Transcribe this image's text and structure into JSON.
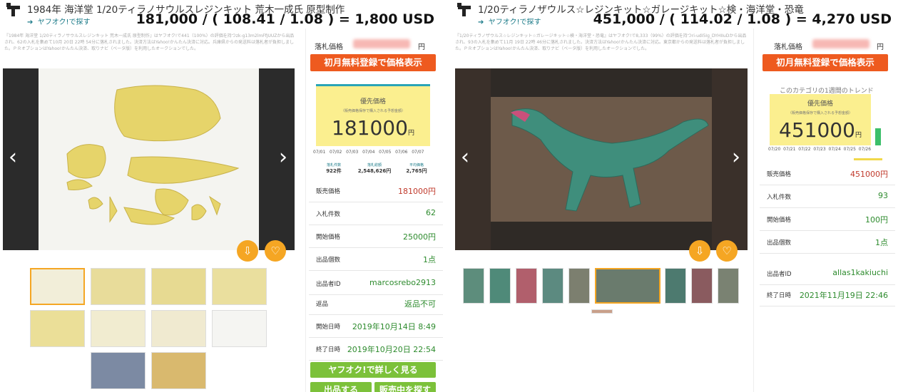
{
  "left": {
    "title": "1984年 海洋堂 1/20ティラノサウルスレジンキット 荒木一成氏 原型制作",
    "yahoo_link": "ヤフオク!で探す",
    "formula": "181,000 / ( 108.41 / 1.08 ) = 1,800 USD",
    "description": "『1984年 海洋堂 1/20ティラノサウルスレジンキット 荒木一成氏 原型制作』はヤフオク!で441（100%）の評価を持つzk-g13m2lmFfJUUZから出品され、62の入札を集めて10月 20日 22時 54分に落札されました。決済方法はYahoo!かんたん決済に対応。兵庫県からの発送料は落札者が負担しました。ＰＲオプションはYahoo!かんたん決済、取りナビ（ベータ版）を利用したオークションでした。",
    "price_label": "落札価格",
    "price_unit": "円",
    "register_button": "初月無料登録で価格表示",
    "priority_label": "優先価格",
    "priority_note": "（販売価格保存で購入される予想金額）",
    "priority_value": "181000",
    "priority_unit": "円",
    "dates": [
      "07/01",
      "07/02",
      "07/03",
      "07/04",
      "07/05",
      "07/06",
      "07/07"
    ],
    "stats": [
      {
        "label": "落札件数",
        "value": "922件"
      },
      {
        "label": "落札総額",
        "value": "2,548,626円"
      },
      {
        "label": "平均価格",
        "value": "2,765円"
      }
    ],
    "rows": [
      {
        "key": "販売価格",
        "value": "181000円",
        "red": true
      },
      {
        "key": "入札件数",
        "value": "62"
      },
      {
        "key": "開始価格",
        "value": "25000円"
      },
      {
        "key": "出品個数",
        "value": "1点"
      },
      {
        "key": "出品者ID",
        "value": "marcosrebo2913"
      },
      {
        "key": "返品",
        "value": "返品不可"
      },
      {
        "key": "開始日時",
        "value": "2019年10月14日 8:49"
      },
      {
        "key": "終了日時",
        "value": "2019年10月20日 22:54"
      }
    ],
    "detail_button": "ヤフオク!で詳しく見る",
    "sell_button": "出品する",
    "search_button": "販売中を探す"
  },
  "right": {
    "title": "1/20ティラノザウルス☆レジンキット☆ガレージキット☆検・海洋堂・恐竜",
    "yahoo_link": "ヤフオク!で探す",
    "formula": "451,000 / ( 114.02 / 1.08 ) = 4,270 USD",
    "description": "『1/20ティラノザウルス☆レジンキット☆ガレージキット☆検・海洋堂・恐竜』はヤフオク!で8,333（99%）の評価を持つri-udI5Ig_DYHIIuDから出品され、93の入札を集めて11月 19日 22時 46分に落札されました。決済方法はYahoo!かんたん決済に対応。東京都からの発送料は落札者が負担しました。ＰＲオプションはYahoo!かんたん決済、取りナビ（ベータ版）を利用したオークションでした。",
    "price_label": "落札価格",
    "price_unit": "円",
    "register_button": "初月無料登録で価格表示",
    "trend_label": "このカテゴリの1週間のトレンド",
    "priority_label": "優先価格",
    "priority_note": "（販売価格保存で購入される予想金額）",
    "priority_value": "451000",
    "priority_unit": "円",
    "dates": [
      "07/20",
      "07/21",
      "07/22",
      "07/23",
      "07/24",
      "07/25",
      "07/26"
    ],
    "rows": [
      {
        "key": "販売価格",
        "value": "451000円",
        "red": true
      },
      {
        "key": "入札件数",
        "value": "93"
      },
      {
        "key": "開始価格",
        "value": "100円"
      },
      {
        "key": "出品個数",
        "value": "1点"
      },
      {
        "key": "出品者ID",
        "value": "allas1kakiuchi"
      },
      {
        "key": "終了日時",
        "value": "2021年11月19日 22:46"
      }
    ]
  },
  "icons": {
    "prev": "chevron-left-icon",
    "next": "chevron-right-icon",
    "share": "share-icon",
    "watch": "heart-icon",
    "logo": "tool-logo-icon",
    "arrow": "arrow-right-icon"
  },
  "colors": {
    "orange": "#ee5a1f",
    "yellow": "#fbef8f",
    "green": "#2e8b2e",
    "red": "#c0392b",
    "teal": "#1a7a88",
    "accent": "#f5a623"
  }
}
